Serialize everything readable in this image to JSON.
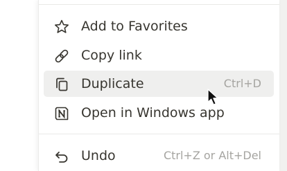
{
  "menu": {
    "items": [
      {
        "label": "Add to Favorites",
        "icon": "star-icon"
      },
      {
        "label": "Copy link",
        "icon": "link-icon"
      },
      {
        "label": "Duplicate",
        "shortcut": "Ctrl+D",
        "icon": "duplicate-icon"
      },
      {
        "label": "Open in Windows app",
        "icon": "notion-app-icon"
      },
      {
        "label": "Undo",
        "shortcut": "Ctrl+Z or Alt+Del",
        "icon": "undo-icon"
      }
    ]
  },
  "colors": {
    "text": "#37352f",
    "shortcut": "#a5a4a0",
    "hover": "#efefee",
    "divider": "#e9e9e7"
  }
}
